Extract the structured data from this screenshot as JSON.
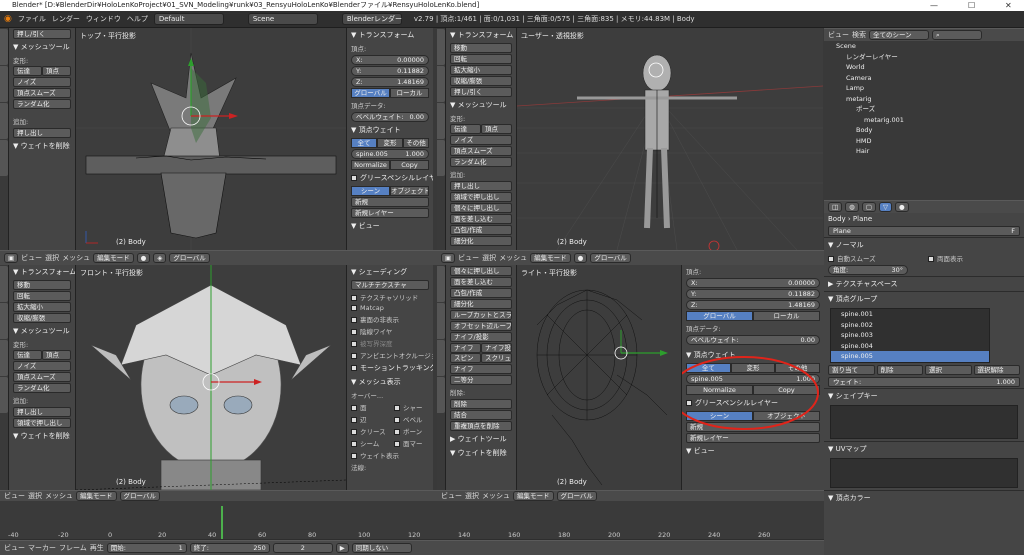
{
  "titlebar": {
    "title": "Blender* [D:¥BlenderDir¥HoloLenKoProject¥01_SVN_Modeling¥runk¥03_RensyuHoloLenKo¥Blenderファイル¥RensyuHoloLenKo.blend]",
    "minimize": "—",
    "maximize": "☐",
    "close": "✕"
  },
  "infobar": {
    "menus": [
      "ファイル",
      "レンダー",
      "ウィンドウ",
      "ヘルプ"
    ],
    "layout": "Default",
    "scene": "Scene",
    "engine": "Blenderレンダー",
    "stats": "v2.79 | 頂点:1/461 | 面:0/1,031 | 三角面:0/575 | 三角面:835 | メモリ:44.83M | Body"
  },
  "viewports": {
    "top": {
      "label": "トップ・平行投影",
      "obj": "(2) Body"
    },
    "user": {
      "label": "ユーザー・透視投影",
      "obj": "(2) Body"
    },
    "front": {
      "label": "フロント・平行投影",
      "obj": "(2) Body"
    },
    "right": {
      "label": "ライト・平行投影",
      "obj": "(2) Body"
    }
  },
  "toolshelf_tl": {
    "top_btn": "押し/引く",
    "mesh_tools": "▼ メッシュツール",
    "deform": "変形:",
    "row1": [
      "伝達",
      "頂点"
    ],
    "btns": [
      "ノイズ",
      "頂点スムーズ",
      "ランダム化"
    ],
    "add": "追加:",
    "extrude": "押し出し",
    "weight_del": "▼ ウェイトを削除"
  },
  "toolshelf_tr": {
    "transform": "▼ トランスフォーム",
    "btns1": [
      "移動",
      "回転",
      "拡大縮小",
      "収縮/膨張",
      "押し/引く"
    ],
    "mesh_tools": "▼ メッシュツール",
    "deform": "変形:",
    "row1": [
      "伝達",
      "頂点"
    ],
    "btns2": [
      "ノイズ",
      "頂点スムーズ",
      "ランダム化"
    ],
    "add": "追加:",
    "btns3": [
      "押し出し",
      "領域で押し出し",
      "個々に押し出し",
      "面を差し込む",
      "凸包/作成",
      "細分化"
    ]
  },
  "toolshelf_bl": {
    "transform": "▼ トランスフォーム",
    "btns1": [
      "移動",
      "回転",
      "拡大縮小",
      "収縮/膨張"
    ],
    "mesh_tools": "▼ メッシュツール",
    "deform": "変形:",
    "row1": [
      "伝達",
      "頂点"
    ],
    "btns2": [
      "ノイズ",
      "頂点スムーズ",
      "ランダム化"
    ],
    "add": "追加:",
    "btns3": [
      "押し出し",
      "領域で押し出し"
    ],
    "weight_del": "▼ ウェイトを削除"
  },
  "toolshelf_br": {
    "btns1": [
      "個々に押し出し",
      "面を差し込む",
      "凸包/作成",
      "細分化",
      "ループカットとスライド",
      "オフセット辺ループ",
      "ナイフ/投影"
    ],
    "row_a": [
      "ナイフ",
      "ナイフ投影"
    ],
    "row_b": [
      "スピン",
      "スクリュー"
    ],
    "btns2": [
      "ナイフ",
      "二等分"
    ],
    "delete": "削除:",
    "del_btns": [
      "削除",
      "結合",
      "重複頂点を削除"
    ],
    "weight_tools": "▶ ウェイトツール",
    "weight_del": "▼ ウェイトを削除"
  },
  "npanel": {
    "transform": "▼ トランスフォーム",
    "vertex": "頂点:",
    "x": "X:",
    "xv": "0.00000",
    "y": "Y:",
    "yv": "0.11882",
    "z": "Z:",
    "zv": "1.48169",
    "global": "グローバル",
    "local": "ローカル",
    "vdata": "頂点データ:",
    "bevel": "ベベルウェイト:",
    "bevel_v": "0.00",
    "vweights": "▼ 頂点ウェイト",
    "tabs": [
      "全て",
      "変形",
      "その他"
    ],
    "group": "spine.005",
    "group_v": "1.000",
    "normalize": "Normalize",
    "copy": "Copy",
    "gpencil": "グリースペンシルレイヤー",
    "scene": "シーン",
    "object": "オブジェクト",
    "new": "新規",
    "new_layer": "新規レイヤー",
    "view": "▼ ビュー"
  },
  "npanel_front": {
    "shading": "▼ シェーディング",
    "material": "マルチテクスチャ",
    "opts": [
      "テクスチャソリッド",
      "Matcap",
      "裏面の非表示",
      "陰線ワイヤ",
      "被写界深度",
      "アンビエントオクルージョン(AO)"
    ],
    "motion": "モーショントラッキング",
    "mesh_display": "▼ メッシュ表示",
    "overlay": "オーバー...",
    "chk_left": [
      "面",
      "辺",
      "クリース",
      "シーム"
    ],
    "chk_right": [
      "シャー",
      "ベベル",
      "ボーン",
      "面マー"
    ],
    "weight_show": "ウェイト表示",
    "normals": "法線:"
  },
  "headers": {
    "view": "ビュー",
    "select": "選択",
    "mesh": "メッシュ",
    "mode": "編集モード",
    "global": "グローバル"
  },
  "outliner": {
    "view": "ビュー",
    "search": "検索",
    "scenes": "全てのシーン",
    "items": [
      "Scene",
      "レンダーレイヤー",
      "World",
      "Camera",
      "Lamp",
      "metarig",
      "ポーズ",
      "metarig.001",
      "Body",
      "HMD",
      "Hair"
    ]
  },
  "props": {
    "obj": "Body",
    "mesh": "Plane",
    "mesh_name": "Plane",
    "f": "F",
    "normals": "▼ ノーマル",
    "autosmooth": "自動スムーズ",
    "double": "両面表示",
    "angle": "角度:",
    "angle_v": "30°",
    "texspace": "▶ テクスチャスペース",
    "vgroups": "▼ 頂点グループ",
    "groups": [
      "spine.001",
      "spine.002",
      "spine.003",
      "spine.004",
      "spine.005"
    ],
    "assign": "割り当て",
    "remove": "削除",
    "select": "選択",
    "deselect": "選択解除",
    "weight": "ウェイト:",
    "weight_v": "1.000",
    "shapekeys": "▼ シェイプキー",
    "uvmaps": "▼ UVマップ",
    "vcolors": "▼ 頂点カラー"
  },
  "timeline": {
    "ticks": [
      "-40",
      "-20",
      "0",
      "20",
      "40",
      "60",
      "80",
      "100",
      "120",
      "140",
      "160",
      "180",
      "200",
      "220",
      "240",
      "260"
    ],
    "menus": [
      "ビュー",
      "マーカー",
      "フレーム",
      "再生"
    ],
    "start": "開始:",
    "start_v": "1",
    "end": "終了:",
    "end_v": "250",
    "frame": "2",
    "sync": "同期しない"
  },
  "colors": {
    "accent": "#5680c2",
    "highlight_circle": "#e0241a"
  }
}
